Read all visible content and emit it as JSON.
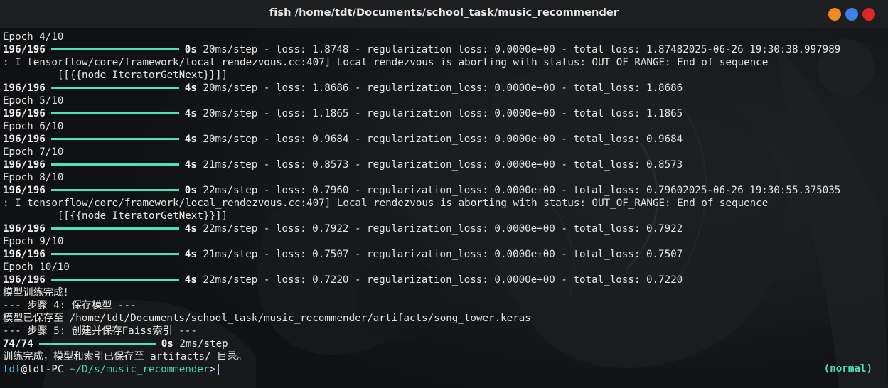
{
  "window": {
    "title": "fish /home/tdt/Documents/school_task/music_recommender",
    "buttons": {
      "minimize": "minimize-icon",
      "maximize": "maximize-icon",
      "close": "close-icon"
    },
    "colors": {
      "minimize": "#f08a22",
      "maximize": "#3f7fe8",
      "close": "#e02727"
    }
  },
  "terminal": {
    "progress_color": "#4fe0b5",
    "lines": [
      "Epoch 4/10",
      {
        "count": "196/196",
        "time": "0s",
        "rest": " 20ms/step - loss: 1.8748 - regularization_loss: 0.0000e+00 - total_loss: 1.87482025-06-26 19:30:38.997989"
      },
      ": I tensorflow/core/framework/local_rendezvous.cc:407] Local rendezvous is aborting with status: OUT_OF_RANGE: End of sequence",
      "\t [[{{node IteratorGetNext}}]]",
      {
        "count": "196/196",
        "time": "4s",
        "rest": " 20ms/step - loss: 1.8686 - regularization_loss: 0.0000e+00 - total_loss: 1.8686"
      },
      "Epoch 5/10",
      {
        "count": "196/196",
        "time": "4s",
        "rest": " 20ms/step - loss: 1.1865 - regularization_loss: 0.0000e+00 - total_loss: 1.1865"
      },
      "Epoch 6/10",
      {
        "count": "196/196",
        "time": "4s",
        "rest": " 20ms/step - loss: 0.9684 - regularization_loss: 0.0000e+00 - total_loss: 0.9684"
      },
      "Epoch 7/10",
      {
        "count": "196/196",
        "time": "4s",
        "rest": " 21ms/step - loss: 0.8573 - regularization_loss: 0.0000e+00 - total_loss: 0.8573"
      },
      "Epoch 8/10",
      {
        "count": "196/196",
        "time": "0s",
        "rest": " 22ms/step - loss: 0.7960 - regularization_loss: 0.0000e+00 - total_loss: 0.79602025-06-26 19:30:55.375035"
      },
      ": I tensorflow/core/framework/local_rendezvous.cc:407] Local rendezvous is aborting with status: OUT_OF_RANGE: End of sequence",
      "\t [[{{node IteratorGetNext}}]]",
      {
        "count": "196/196",
        "time": "4s",
        "rest": " 22ms/step - loss: 0.7922 - regularization_loss: 0.0000e+00 - total_loss: 0.7922"
      },
      "Epoch 9/10",
      {
        "count": "196/196",
        "time": "4s",
        "rest": " 21ms/step - loss: 0.7507 - regularization_loss: 0.0000e+00 - total_loss: 0.7507"
      },
      "Epoch 10/10",
      {
        "count": "196/196",
        "time": "4s",
        "rest": " 22ms/step - loss: 0.7220 - regularization_loss: 0.0000e+00 - total_loss: 0.7220"
      },
      "模型训练完成！",
      "--- 步骤 4: 保存模型 ---",
      "模型已保存至 /home/tdt/Documents/school_task/music_recommender/artifacts/song_tower.keras",
      "--- 步骤 5: 创建并保存Faiss索引 ---",
      {
        "count": "74/74",
        "time": "0s",
        "rest": " 2ms/step",
        "short": true
      },
      "训练完成，模型和索引已保存至 artifacts/ 目录。"
    ],
    "prompt": {
      "user": "tdt",
      "at_host": "@tdt-PC",
      "path": "~/D/s/music_recommender",
      "symbol": ">",
      "mode": "(normal)"
    }
  }
}
